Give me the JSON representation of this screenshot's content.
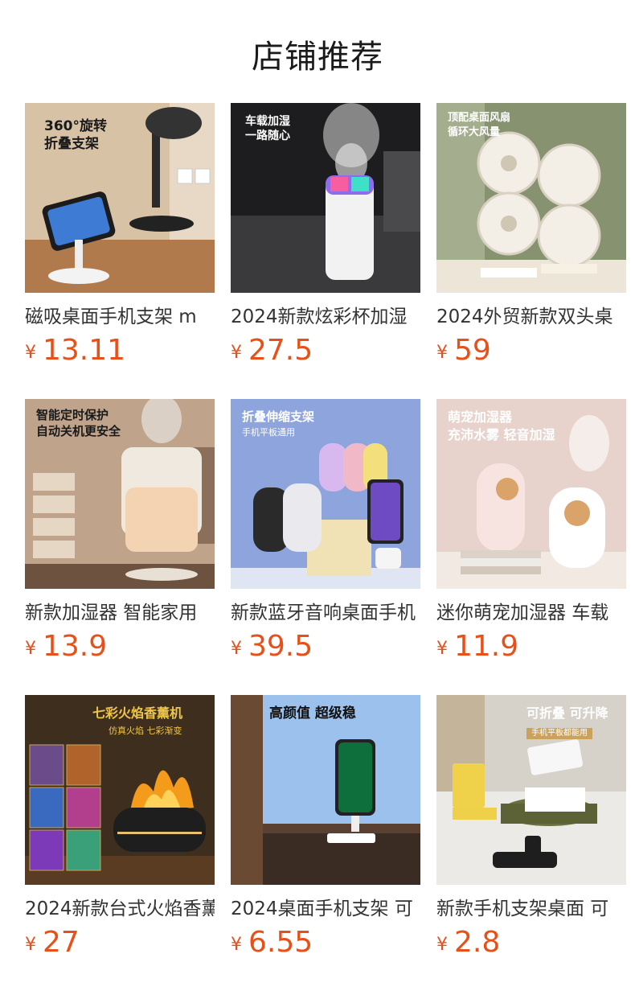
{
  "page_title": "店铺推荐",
  "products": [
    {
      "name": "磁吸桌面手机支架 m",
      "currency": "¥",
      "price": "13.11",
      "img_text": [
        "360°旋转",
        "折叠支架"
      ],
      "img_bg": "#d9c3a8"
    },
    {
      "name": "2024新款炫彩杯加湿",
      "currency": "¥",
      "price": "27.5",
      "img_text": [
        "车载加湿",
        "一路随心"
      ],
      "img_bg": "#2a2a2a"
    },
    {
      "name": "2024外贸新款双头桌",
      "currency": "¥",
      "price": "59",
      "img_text": [
        "顶配桌面风扇",
        "循环大风量"
      ],
      "img_bg": "#8a9673"
    },
    {
      "name": "新款加湿器 智能家用",
      "currency": "¥",
      "price": "13.9",
      "img_text": [
        "智能定时保护",
        "自动关机更安全"
      ],
      "img_bg": "#b89b80"
    },
    {
      "name": "新款蓝牙音响桌面手机",
      "currency": "¥",
      "price": "39.5",
      "img_text": [
        "折叠伸缩支架",
        "手机平板通用"
      ],
      "img_bg": "#8fa6dd"
    },
    {
      "name": "迷你萌宠加湿器 车载",
      "currency": "¥",
      "price": "11.9",
      "img_text": [
        "萌宠加湿器",
        "充沛水雾 轻音加湿"
      ],
      "img_bg": "#e6d2ca"
    },
    {
      "name": "2024新款台式火焰香薰",
      "currency": "¥",
      "price": "27",
      "img_text": [
        "七彩火焰香薰机",
        "仿真火焰 七彩渐变"
      ],
      "img_bg": "#3a2a1a"
    },
    {
      "name": "2024桌面手机支架 可",
      "currency": "¥",
      "price": "6.55",
      "img_text": [
        "高颜值 超级稳"
      ],
      "img_bg": "#9dc1ec"
    },
    {
      "name": "新款手机支架桌面 可",
      "currency": "¥",
      "price": "2.8",
      "img_text": [
        "可折叠 可升降",
        "手机平板都能用"
      ],
      "img_bg": "#d8d4cc"
    }
  ]
}
